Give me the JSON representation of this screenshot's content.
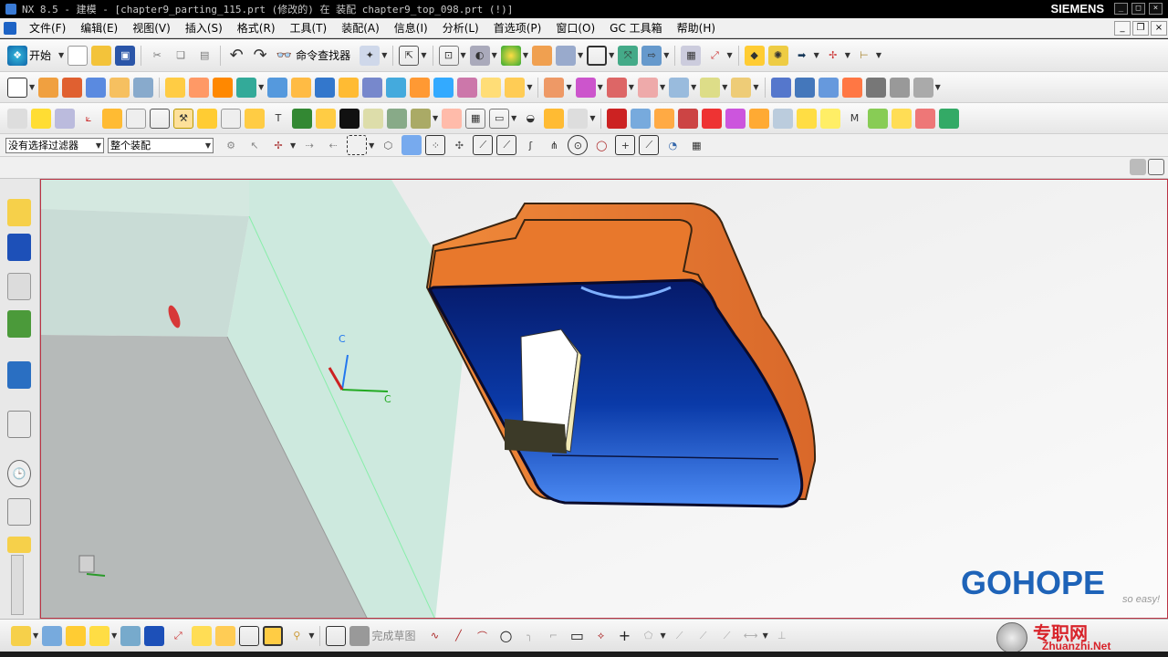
{
  "window": {
    "title": "NX 8.5 - 建模 - [chapter9_parting_115.prt (修改的)  在 装配 chapter9_top_098.prt   (!)]",
    "brand": "SIEMENS",
    "controls": [
      "_",
      "□",
      "×"
    ]
  },
  "menu": {
    "items": [
      "文件(F)",
      "编辑(E)",
      "视图(V)",
      "插入(S)",
      "格式(R)",
      "工具(T)",
      "装配(A)",
      "信息(I)",
      "分析(L)",
      "首选项(P)",
      "窗口(O)",
      "GC 工具箱",
      "帮助(H)"
    ]
  },
  "toolbar1": {
    "start_label": "开始",
    "command_finder_label": "命令查找器"
  },
  "filterbar": {
    "selection_filter": "没有选择过滤器",
    "scope": "整个装配"
  },
  "bottom_toolbar": {
    "finish_sketch_label": "完成草图"
  },
  "viewport": {
    "csys_label": "C",
    "watermark_brand": "GOHOPE",
    "watermark_site": "专职网",
    "watermark_url": "Zhuanzhi.Net",
    "watermark_tagline": "so easy!"
  },
  "colors": {
    "orange": "#e8782c",
    "blue": "#1f5fe8",
    "navy": "#061a6a",
    "brand_blue": "#1e63b8",
    "site_red": "#d8232a"
  }
}
